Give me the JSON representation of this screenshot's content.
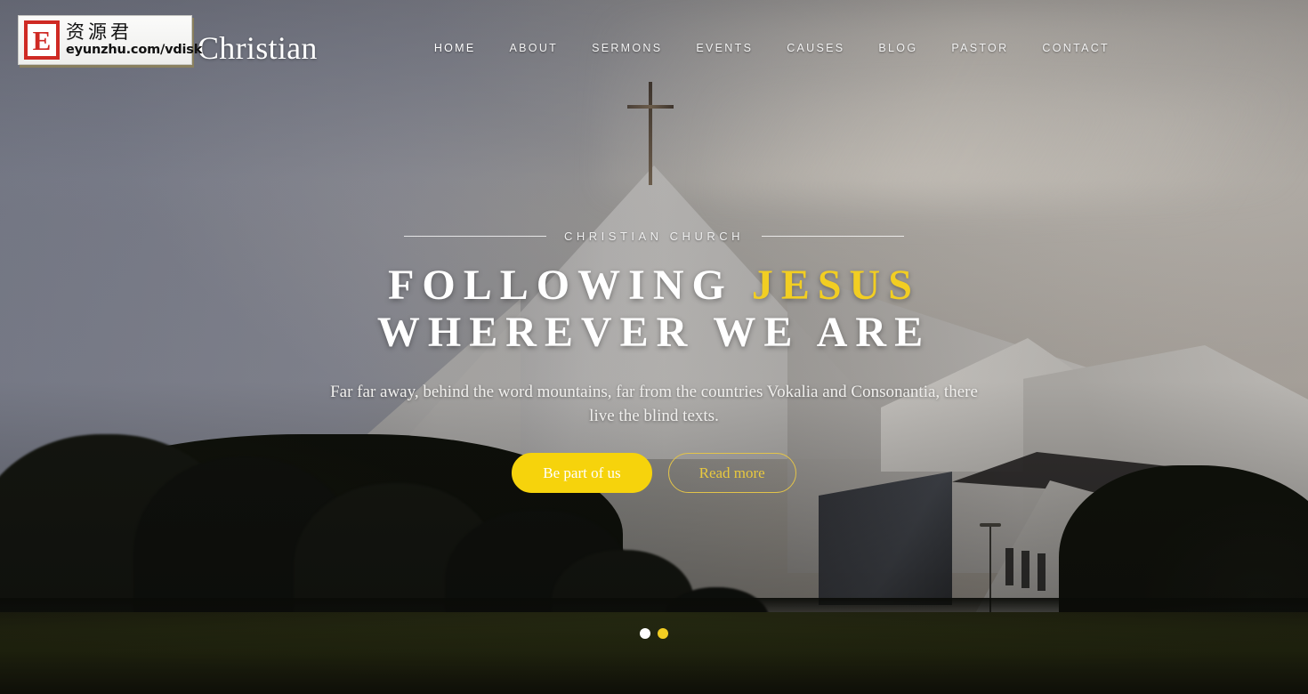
{
  "brand": {
    "name": "Christian"
  },
  "watermark": {
    "letter": "E",
    "chinese": "资源君",
    "url": "eyunzhu.com/vdisk"
  },
  "nav": {
    "items": [
      {
        "label": "HOME",
        "active": true
      },
      {
        "label": "ABOUT",
        "active": false
      },
      {
        "label": "SERMONS",
        "active": false
      },
      {
        "label": "EVENTS",
        "active": false
      },
      {
        "label": "CAUSES",
        "active": false
      },
      {
        "label": "BLOG",
        "active": false
      },
      {
        "label": "PASTOR",
        "active": false
      },
      {
        "label": "CONTACT",
        "active": false
      }
    ]
  },
  "hero": {
    "eyebrow": "CHRISTIAN CHURCH",
    "headline_line1_plain": "FOLLOWING",
    "headline_line1_highlight": "JESUS",
    "headline_line2": "WHEREVER WE ARE",
    "lead": "Far far away, behind the word mountains, far from the countries Vokalia and Consonantia, there live the blind texts.",
    "primary_button": "Be part of us",
    "secondary_button": "Read more"
  },
  "carousel": {
    "slides": [
      {
        "index": 1,
        "active": false
      },
      {
        "index": 2,
        "active": true
      }
    ]
  },
  "colors": {
    "accent_yellow": "#f6d30c",
    "headline_highlight": "#f2ce22",
    "ghost_button_border": "#e2c34a",
    "text_white": "#ffffff",
    "sky_left": "#7e8290",
    "sky_right": "#b8b0a6",
    "grass": "#343a12",
    "watermark_red": "#cf2a24"
  }
}
